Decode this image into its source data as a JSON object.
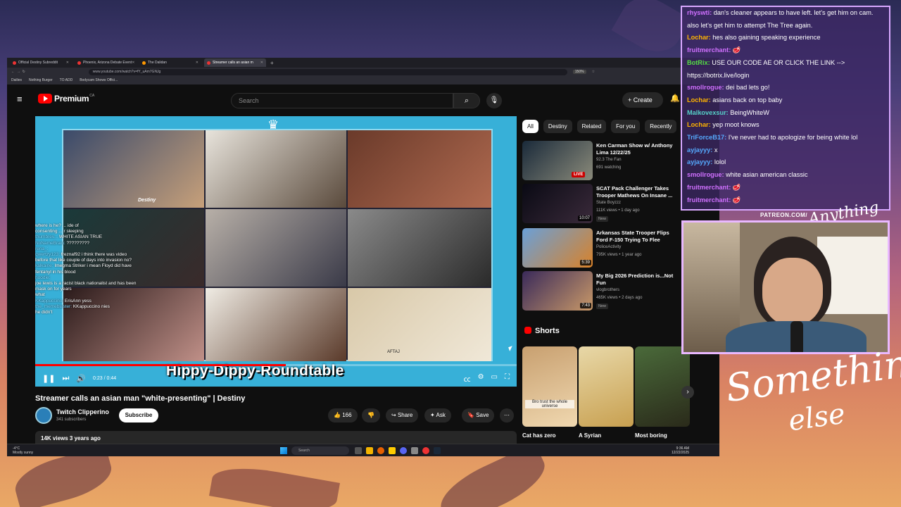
{
  "browser": {
    "tabs": [
      {
        "label": "Official Destiny Subreddit",
        "active": false
      },
      {
        "label": "Phoenix, Arizona Debate Event",
        "active": false
      },
      {
        "label": "The Dalidan",
        "active": false
      },
      {
        "label": "Streamer calls an asian m",
        "active": true
      }
    ],
    "url": "www.youtube.com/watch?v=fY_uAm7GNJg",
    "zoom": "150%",
    "bookmarks": [
      "Dailies",
      "Nothing Burger",
      "TO ADD",
      "Bodycam Shows Offici..."
    ]
  },
  "youtube": {
    "logo_text": "Premium",
    "logo_region": "CA",
    "search_placeholder": "Search",
    "create_label": "Create",
    "video_title": "Streamer calls an asian man \"white-presenting\" | Destiny",
    "channel_name": "Twitch Clipperino",
    "subscribers": "341 subscribers",
    "subscribe_label": "Subscribe",
    "likes": "166",
    "share_label": "Share",
    "ask_label": "Ask",
    "save_label": "Save",
    "views_date": "14K views  3 years ago",
    "player": {
      "time": "0:23 / 0:44",
      "progress_fraction": 0.52,
      "overlay_title": "Hippy-Dippy-Roundtable",
      "destiny_tag": "Destiny",
      "aftaj": "AFTAJ"
    },
    "stream_chat": [
      {
        "user": "",
        "text": "where is he? ... ide of"
      },
      {
        "user": "",
        "text": "consenting ... r sleeping"
      },
      {
        "user": "thumbrev...",
        "text": "WHITE ASIAN TRUE"
      },
      {
        "user": "NoNameBrain:",
        "text": "?????????"
      },
      {
        "user": "rena_:",
        "text": ""
      },
      {
        "user": "qwertzy123:",
        "text": "freznaf92 i think there was video before that like couple of days into invasion no?"
      },
      {
        "user": "kalkaine:",
        "text": "Imegma Striker i mean Floyd did have fentanyl in his blood"
      },
      {
        "user": "hoodie:",
        "text": ""
      },
      {
        "user": "",
        "text": "joe lewis is a racist black nationalist and has been mask on for years"
      },
      {
        "user": "",
        "text": "what"
      },
      {
        "user": "KKappuccino:",
        "text": "ErisAnn yess"
      },
      {
        "user": "the_memeblaster:",
        "text": "KKappuccino nies"
      },
      {
        "user": "",
        "text": "he didn't"
      }
    ],
    "chips": [
      "All",
      "Destiny",
      "Related",
      "For you",
      "Recently"
    ],
    "recommended": [
      {
        "title": "Ken Carman Show w/ Anthony Lima 12/22/25",
        "channel": "92.3 The Fan",
        "meta": "691 watching",
        "duration": "",
        "live": "LIVE",
        "badge": ""
      },
      {
        "title": "SCAT Pack Challenger Takes Trooper Mathews On Insane ...",
        "channel": "State Boyzzz",
        "meta": "111K views • 1 day ago",
        "duration": "10:07",
        "live": "",
        "badge": "New"
      },
      {
        "title": "Arkansas State Trooper Flips Ford F-150 Trying To Flee",
        "channel": "PoliceActivity",
        "meta": "795K views • 1 year ago",
        "duration": "5:39",
        "live": "",
        "badge": ""
      },
      {
        "title": "My Big 2026 Prediction is...Not Fun",
        "channel": "vlogbrothers",
        "meta": "465K views • 2 days ago",
        "duration": "7:43",
        "live": "",
        "badge": "New"
      }
    ],
    "shorts_heading": "Shorts",
    "shorts": [
      {
        "title": "Cat has zero",
        "caption": "Bro trust the whole universe"
      },
      {
        "title": "A Syrian",
        "caption": ""
      },
      {
        "title": "Most boring",
        "caption": ""
      }
    ]
  },
  "taskbar": {
    "weather": "-4°C",
    "weather_desc": "Mostly sunny",
    "search": "Search",
    "time": "9:36 AM",
    "date": "12/22/2025"
  },
  "chat": [
    {
      "user": "rhyswti:",
      "text": "dan's cleaner appears to have left. let's get him on cam. also let's get him to attempt The Tree again.",
      "color": "c-p"
    },
    {
      "user": "Lochar:",
      "text": "hes also gaining speaking experience",
      "color": "c-y"
    },
    {
      "user": "fruitmerchant:",
      "text": "🥩",
      "color": "c-p"
    },
    {
      "user": "BotRix:",
      "text": "USE OUR CODE AE OR CLICK THE LINK --> https://botrix.live/login",
      "color": "c-g"
    },
    {
      "user": "smollrogue:",
      "text": "dei bad lets go!",
      "color": "c-p"
    },
    {
      "user": "Lochar:",
      "text": "asians back on top baby",
      "color": "c-y"
    },
    {
      "user": "Malkovexsur:",
      "text": "BeingWhiteW",
      "color": "c-t"
    },
    {
      "user": "Lochar:",
      "text": "yep moot knows",
      "color": "c-y"
    },
    {
      "user": "TriForceB17:",
      "text": "I've never had to apologize for being white lol",
      "color": "c-b"
    },
    {
      "user": "ayjayyy:",
      "text": "x",
      "color": "c-b"
    },
    {
      "user": "ayjayyy:",
      "text": "lolol",
      "color": "c-b"
    },
    {
      "user": "smollrogue:",
      "text": "white asian american classic",
      "color": "c-p"
    },
    {
      "user": "fruitmerchant:",
      "text": "🥩",
      "color": "c-p"
    },
    {
      "user": "fruitmerchant:",
      "text": "🥩",
      "color": "c-p"
    }
  ],
  "overlay": {
    "patreon": "PATREON.COM/",
    "script_small": "Anything else",
    "brand_line1": "Something",
    "brand_line2": "else"
  }
}
